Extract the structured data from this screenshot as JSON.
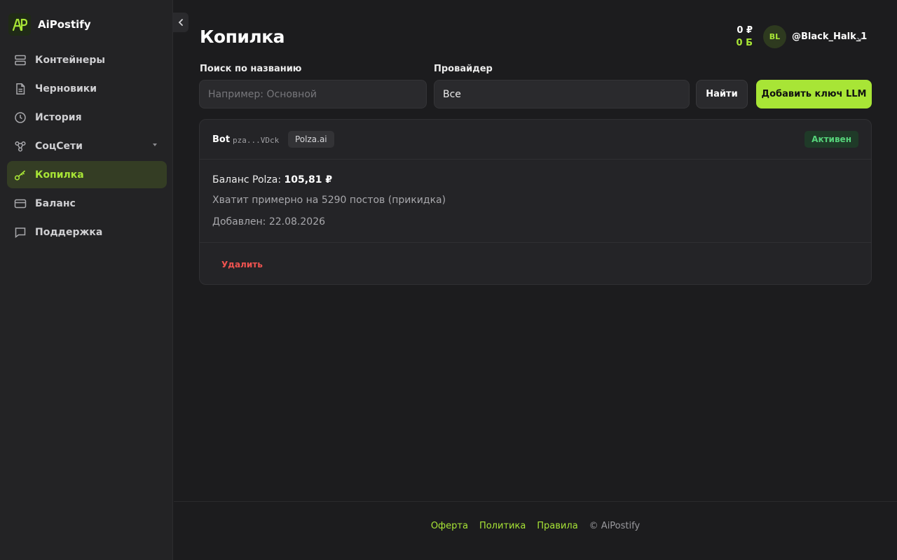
{
  "app": {
    "name": "AiPostify"
  },
  "sidebar": {
    "items": [
      {
        "label": "Контейнеры",
        "icon": "server-icon"
      },
      {
        "label": "Черновики",
        "icon": "document-icon"
      },
      {
        "label": "История",
        "icon": "clock-icon"
      },
      {
        "label": "СоцСети",
        "icon": "share-nodes-icon",
        "has_submenu": true
      },
      {
        "label": "Копилка",
        "icon": "key-icon",
        "active": true
      },
      {
        "label": "Баланс",
        "icon": "credit-card-icon"
      },
      {
        "label": "Поддержка",
        "icon": "chat-bubble-icon"
      }
    ]
  },
  "header": {
    "title": "Копилка",
    "balance_rub": "0 ₽",
    "balance_b": "0 Б",
    "avatar_initials": "BL",
    "username": "@Black_Halk_1"
  },
  "filters": {
    "search_label": "Поиск по названию",
    "search_placeholder": "Например: Основной",
    "search_value": "",
    "provider_label": "Провайдер",
    "provider_value": "Все",
    "find_button": "Найти",
    "add_button": "Добавить ключ LLM"
  },
  "keys": [
    {
      "name": "Bot",
      "masked_key": "pza...VDck",
      "provider": "Polza.ai",
      "status": "Активен",
      "balance_label": "Баланс Polza:",
      "balance_value": "105,81 ₽",
      "estimate": "Хватит примерно на 5290 постов (прикидка)",
      "added": "Добавлен: 22.08.2026",
      "delete_label": "Удалить"
    }
  ],
  "footer": {
    "links": [
      "Оферта",
      "Политика",
      "Правила"
    ],
    "copyright": "© AiPostify"
  },
  "colors": {
    "accent": "#a8e536",
    "background": "#1c1c1e",
    "sidebar": "#232325",
    "danger": "#ef5350",
    "success": "#56d37a"
  }
}
